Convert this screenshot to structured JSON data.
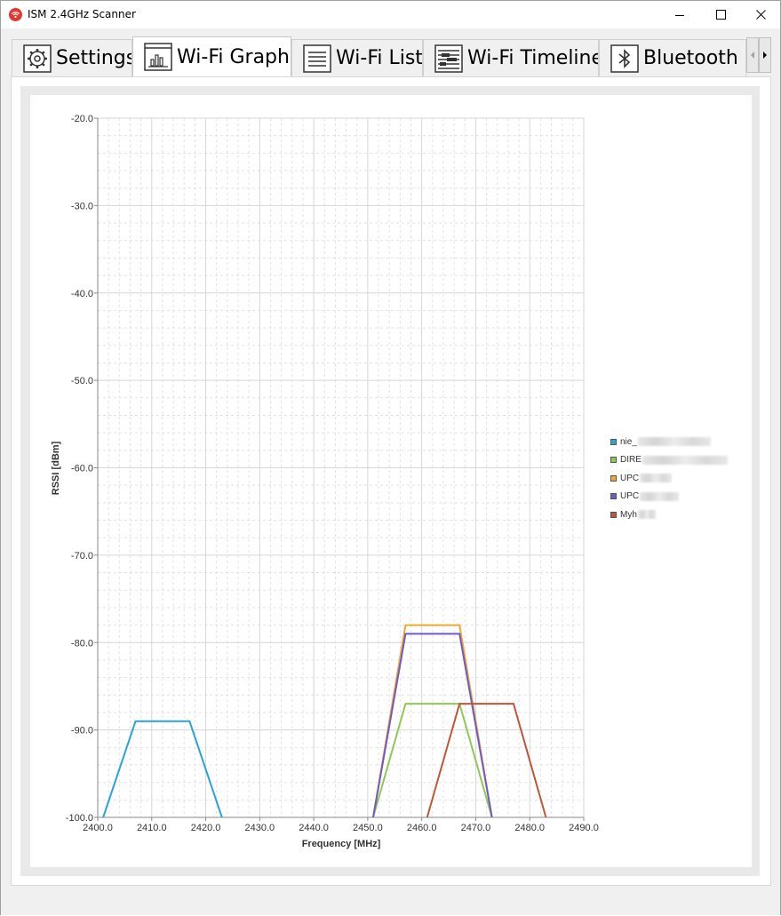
{
  "window": {
    "title": "ISM 2.4GHz Scanner",
    "minimize_icon": "minimize-icon",
    "maximize_icon": "maximize-icon",
    "close_icon": "close-icon"
  },
  "tabs": [
    {
      "label": "Settings",
      "icon": "gear-icon",
      "active": false
    },
    {
      "label": "Wi-Fi Graph",
      "icon": "bar-chart-icon",
      "active": true
    },
    {
      "label": "Wi-Fi List",
      "icon": "list-icon",
      "active": false
    },
    {
      "label": "Wi-Fi Timeline",
      "icon": "timeline-icon",
      "active": false
    },
    {
      "label": "Bluetooth Lis",
      "icon": "bluetooth-icon",
      "active": false
    }
  ],
  "legend": [
    {
      "label": "nie_",
      "color": "#2aa3d8"
    },
    {
      "label": "DIRE",
      "color": "#8fc855"
    },
    {
      "label": "UPC",
      "color": "#f0a830"
    },
    {
      "label": "UPC",
      "color": "#6f5ac8"
    },
    {
      "label": "Myh",
      "color": "#c05638"
    }
  ],
  "chart_data": {
    "type": "line",
    "xlabel": "Frequency [MHz]",
    "ylabel": "RSSI [dBm]",
    "xlim": [
      2400.0,
      2490.0
    ],
    "ylim": [
      -100.0,
      -20.0
    ],
    "x_ticks": [
      "2400.0",
      "2410.0",
      "2420.0",
      "2430.0",
      "2440.0",
      "2450.0",
      "2460.0",
      "2470.0",
      "2480.0",
      "2490.0"
    ],
    "y_ticks": [
      "-20.0",
      "-30.0",
      "-40.0",
      "-50.0",
      "-60.0",
      "-70.0",
      "-80.0",
      "-90.0",
      "-100.0"
    ],
    "grid": true,
    "legend_position": "right",
    "series": [
      {
        "name": "nie_",
        "color": "#2aa3d8",
        "x": [
          2401,
          2407,
          2417,
          2423
        ],
        "y": [
          -100,
          -89,
          -89,
          -100
        ]
      },
      {
        "name": "DIRE",
        "color": "#8fc855",
        "x": [
          2451,
          2457,
          2467,
          2473
        ],
        "y": [
          -100,
          -87,
          -87,
          -100
        ]
      },
      {
        "name": "UPC",
        "color": "#f0a830",
        "x": [
          2451,
          2457,
          2467,
          2473
        ],
        "y": [
          -100,
          -78,
          -78,
          -100
        ]
      },
      {
        "name": "UPC",
        "color": "#6f5ac8",
        "x": [
          2451,
          2457,
          2467,
          2473
        ],
        "y": [
          -100,
          -79,
          -79,
          -100
        ]
      },
      {
        "name": "Myh",
        "color": "#c05638",
        "x": [
          2461,
          2467,
          2477,
          2483
        ],
        "y": [
          -100,
          -87,
          -87,
          -100
        ]
      }
    ]
  }
}
